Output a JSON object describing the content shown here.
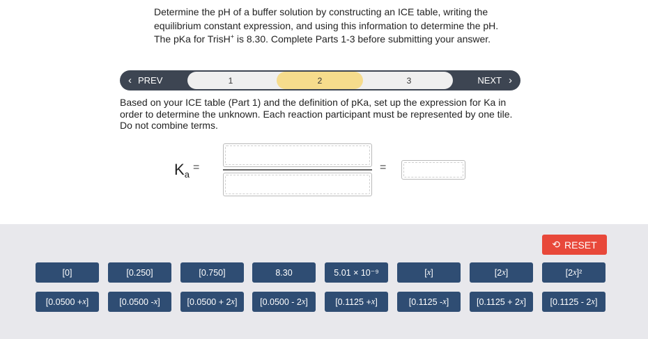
{
  "question": {
    "text_before_sup": "Determine the pH of a buffer solution by constructing an ICE table, writing the equilibrium constant expression, and using this information to determine the pH. The pKa for TrisH",
    "sup": "+",
    "text_after_sup": " is 8.30. Complete Parts 1-3 before submitting your answer."
  },
  "stepper": {
    "prev_label": "PREV",
    "next_label": "NEXT",
    "prev_icon": "chevron-left-icon",
    "next_icon": "chevron-right-icon",
    "steps": [
      "1",
      "2",
      "3"
    ],
    "active_step": "2",
    "active_color": "#f6dc8c"
  },
  "instructions": "Based on your ICE table (Part 1) and the definition of pKa, set up the expression for Ka in order to determine the unknown. Each reaction participant must be represented by one tile. Do not combine terms.",
  "equation": {
    "lhs_symbol": "K",
    "lhs_sub": "a",
    "equals": "=",
    "equals2": "="
  },
  "reset": {
    "label": "RESET",
    "icon": "undo-icon",
    "color": "#e8483a"
  },
  "tiles": {
    "row1": [
      "[0]",
      "[0.250]",
      "[0.750]",
      "8.30",
      "5.01 × 10⁻⁹",
      "[x]",
      "[2x]",
      "[2x]²"
    ],
    "row2": [
      "[0.0500 + x]",
      "[0.0500 - x]",
      "[0.0500 + 2x]",
      "[0.0500 - 2x]",
      "[0.1125 + x]",
      "[0.1125 - x]",
      "[0.1125 + 2x]",
      "[0.1125 - 2x]"
    ],
    "color": "#2f4d73"
  }
}
